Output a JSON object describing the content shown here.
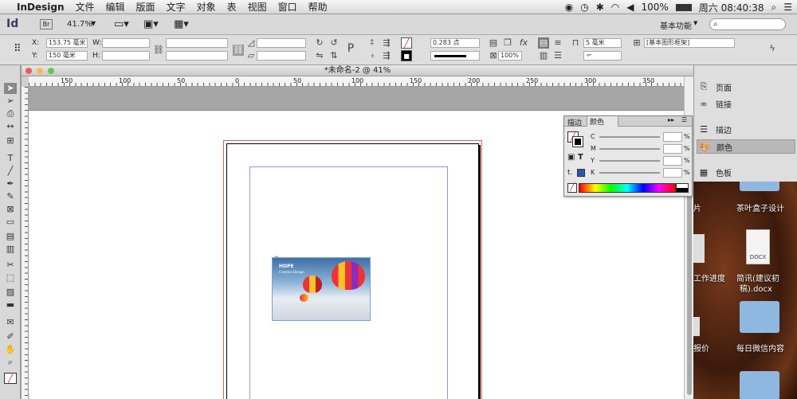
{
  "menubar": {
    "apple": "",
    "app_name": "InDesign",
    "items": [
      "文件",
      "编辑",
      "版面",
      "文字",
      "对象",
      "表",
      "视图",
      "窗口",
      "帮助"
    ],
    "battery": "100%",
    "datetime": "周六 08:40:38"
  },
  "appbar": {
    "logo": "Id",
    "bridge": "Br",
    "zoom": "41.7%",
    "workspace": "基本功能",
    "search_placeholder": ""
  },
  "control": {
    "x_label": "X:",
    "x_value": "153.75 毫米",
    "y_label": "Y:",
    "y_value": "150 毫米",
    "w_label": "W:",
    "h_label": "H:",
    "stroke_weight": "0.283 点",
    "scale": "100%",
    "gap": "5 毫米",
    "object_style": "[基本图形框架]"
  },
  "document": {
    "title": "*未命名-2 @ 41%",
    "ruler_labels": [
      "150",
      "100",
      "50",
      "0",
      "50",
      "100",
      "150",
      "200",
      "250",
      "300",
      "350"
    ]
  },
  "panel": {
    "tab_stroke": "描边",
    "tab_color": "颜色",
    "channels": [
      "C",
      "M",
      "Y",
      "K"
    ],
    "percent": "%"
  },
  "right_panel": {
    "items": [
      "页面",
      "链接",
      "描边",
      "颜色",
      "色板"
    ]
  },
  "desktop": {
    "labels": [
      "片",
      "茶叶盒子设计",
      "工作进度",
      "简讯(建议初",
      "稿).docx",
      "DOCX",
      "报价",
      "每日微信内容"
    ]
  },
  "image": {
    "tagline": "HOPE",
    "sub": "Creative Design"
  },
  "colors": {
    "accent": "#d23a3a",
    "margin": "#a48ce0",
    "bleed": "#e05a5a"
  }
}
